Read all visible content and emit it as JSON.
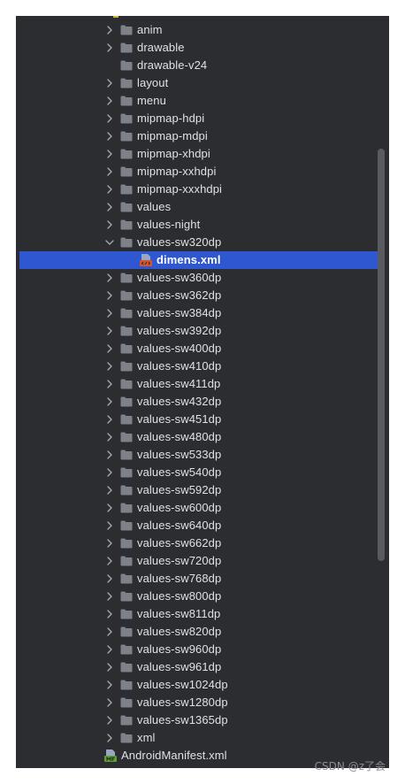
{
  "tree": {
    "items": [
      {
        "label": "anim",
        "kind": "folder",
        "expanded": false
      },
      {
        "label": "drawable",
        "kind": "folder",
        "expanded": false
      },
      {
        "label": "drawable-v24",
        "kind": "folder",
        "expanded": null
      },
      {
        "label": "layout",
        "kind": "folder",
        "expanded": false
      },
      {
        "label": "menu",
        "kind": "folder",
        "expanded": false
      },
      {
        "label": "mipmap-hdpi",
        "kind": "folder",
        "expanded": false
      },
      {
        "label": "mipmap-mdpi",
        "kind": "folder",
        "expanded": false
      },
      {
        "label": "mipmap-xhdpi",
        "kind": "folder",
        "expanded": false
      },
      {
        "label": "mipmap-xxhdpi",
        "kind": "folder",
        "expanded": false
      },
      {
        "label": "mipmap-xxxhdpi",
        "kind": "folder",
        "expanded": false
      },
      {
        "label": "values",
        "kind": "folder",
        "expanded": false
      },
      {
        "label": "values-night",
        "kind": "folder",
        "expanded": false
      },
      {
        "label": "values-sw320dp",
        "kind": "folder",
        "expanded": true
      },
      {
        "label": "dimens.xml",
        "kind": "xml-file",
        "selected": true,
        "child": true
      },
      {
        "label": "values-sw360dp",
        "kind": "folder",
        "expanded": false
      },
      {
        "label": "values-sw362dp",
        "kind": "folder",
        "expanded": false
      },
      {
        "label": "values-sw384dp",
        "kind": "folder",
        "expanded": false
      },
      {
        "label": "values-sw392dp",
        "kind": "folder",
        "expanded": false
      },
      {
        "label": "values-sw400dp",
        "kind": "folder",
        "expanded": false
      },
      {
        "label": "values-sw410dp",
        "kind": "folder",
        "expanded": false
      },
      {
        "label": "values-sw411dp",
        "kind": "folder",
        "expanded": false
      },
      {
        "label": "values-sw432dp",
        "kind": "folder",
        "expanded": false
      },
      {
        "label": "values-sw451dp",
        "kind": "folder",
        "expanded": false
      },
      {
        "label": "values-sw480dp",
        "kind": "folder",
        "expanded": false
      },
      {
        "label": "values-sw533dp",
        "kind": "folder",
        "expanded": false
      },
      {
        "label": "values-sw540dp",
        "kind": "folder",
        "expanded": false
      },
      {
        "label": "values-sw592dp",
        "kind": "folder",
        "expanded": false
      },
      {
        "label": "values-sw600dp",
        "kind": "folder",
        "expanded": false
      },
      {
        "label": "values-sw640dp",
        "kind": "folder",
        "expanded": false
      },
      {
        "label": "values-sw662dp",
        "kind": "folder",
        "expanded": false
      },
      {
        "label": "values-sw720dp",
        "kind": "folder",
        "expanded": false
      },
      {
        "label": "values-sw768dp",
        "kind": "folder",
        "expanded": false
      },
      {
        "label": "values-sw800dp",
        "kind": "folder",
        "expanded": false
      },
      {
        "label": "values-sw811dp",
        "kind": "folder",
        "expanded": false
      },
      {
        "label": "values-sw820dp",
        "kind": "folder",
        "expanded": false
      },
      {
        "label": "values-sw960dp",
        "kind": "folder",
        "expanded": false
      },
      {
        "label": "values-sw961dp",
        "kind": "folder",
        "expanded": false
      },
      {
        "label": "values-sw1024dp",
        "kind": "folder",
        "expanded": false
      },
      {
        "label": "values-sw1280dp",
        "kind": "folder",
        "expanded": false
      },
      {
        "label": "values-sw1365dp",
        "kind": "folder",
        "expanded": false
      },
      {
        "label": "xml",
        "kind": "folder",
        "expanded": false
      },
      {
        "label": "AndroidManifest.xml",
        "kind": "manifest-file",
        "outdented": true
      }
    ]
  },
  "watermark": "CSDN @z了会",
  "colors": {
    "panel_bg": "#2b2d30",
    "selection": "#2e57d0",
    "text": "#dfe1e5",
    "folder": "#7d8189",
    "chevron": "#a8abb0"
  }
}
